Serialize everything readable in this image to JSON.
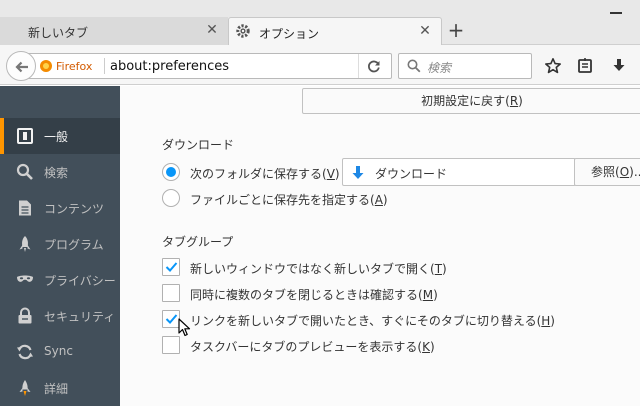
{
  "tabs": [
    {
      "title": "新しいタブ",
      "active": false
    },
    {
      "title": "オプション",
      "active": true
    }
  ],
  "navbar": {
    "identity_label": "Firefox",
    "url": "about:preferences",
    "search_placeholder": "検索"
  },
  "sidebar": {
    "items": [
      {
        "label": "一般",
        "icon": "general-icon",
        "selected": true
      },
      {
        "label": "検索",
        "icon": "search-icon",
        "selected": false
      },
      {
        "label": "コンテンツ",
        "icon": "content-icon",
        "selected": false
      },
      {
        "label": "プログラム",
        "icon": "applications-icon",
        "selected": false
      },
      {
        "label": "プライバシー",
        "icon": "privacy-mask-icon",
        "selected": false
      },
      {
        "label": "セキュリティ",
        "icon": "security-lock-icon",
        "selected": false
      },
      {
        "label": "Sync",
        "icon": "sync-icon",
        "selected": false
      },
      {
        "label": "詳細",
        "icon": "advanced-icon",
        "selected": false
      }
    ]
  },
  "main": {
    "restore_defaults": {
      "label": "初期設定に戻す",
      "key": "R"
    },
    "downloads": {
      "title": "ダウンロード",
      "save_to": {
        "label": "次のフォルダに保存する",
        "key": "V",
        "checked": true
      },
      "folder_name": "ダウンロード",
      "browse": {
        "label": "参照",
        "key": "O",
        "suffix": "..."
      },
      "always_ask": {
        "label": "ファイルごとに保存先を指定する",
        "key": "A",
        "checked": false
      }
    },
    "tab_groups": {
      "title": "タブグループ",
      "options": [
        {
          "label": "新しいウィンドウではなく新しいタブで開く",
          "key": "T",
          "checked": true
        },
        {
          "label": "同時に複数のタブを閉じるときは確認する",
          "key": "M",
          "checked": false
        },
        {
          "label": "リンクを新しいタブで開いたとき、すぐにそのタブに切り替える",
          "key": "H",
          "checked": true
        },
        {
          "label": "タスクバーにタブのプレビューを表示する",
          "key": "K",
          "checked": false
        }
      ]
    }
  },
  "colors": {
    "accent": "#0996f8",
    "sidebar_bg": "#424f5a",
    "selected_marker": "#ff9500"
  }
}
